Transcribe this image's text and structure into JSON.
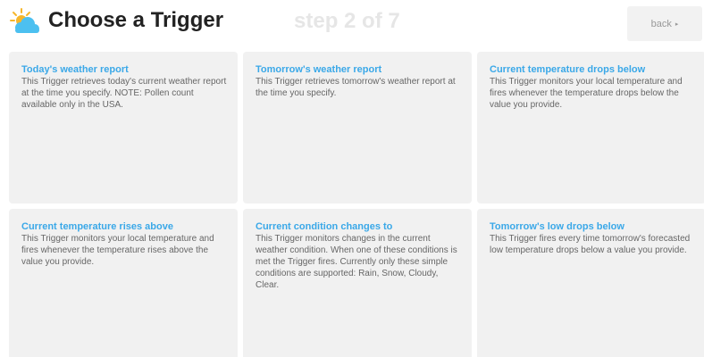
{
  "header": {
    "title": "Choose a Trigger",
    "step": "step 2 of 7",
    "back_label": "back",
    "back_caret": "▸",
    "logo_icon": "sun-cloud-icon"
  },
  "colors": {
    "title": "#222222",
    "step": "#e6e6e6",
    "card_background": "#f1f1f1",
    "card_title": "#3aa8e8",
    "card_text": "#666666",
    "logo_cloud": "#4cc0f0",
    "logo_sun": "#f6b62b"
  },
  "triggers": [
    {
      "title": "Today's weather report",
      "description": "This Trigger retrieves today's current weather report at the time you specify. NOTE: Pollen count available only in the USA."
    },
    {
      "title": "Tomorrow's weather report",
      "description": "This Trigger retrieves tomorrow's weather report at the time you specify."
    },
    {
      "title": "Current temperature drops below",
      "description": "This Trigger monitors your local temperature and fires whenever the temperature drops below the value you provide."
    },
    {
      "title": "Current temperature rises above",
      "description": "This Trigger monitors your local temperature and fires whenever the temperature rises above the value you provide."
    },
    {
      "title": "Current condition changes to",
      "description": "This Trigger monitors changes in the current weather condition. When one of these conditions is met the Trigger fires. Currently only these simple conditions are supported: Rain, Snow, Cloudy, Clear."
    },
    {
      "title": "Tomorrow's low drops below",
      "description": "This Trigger fires every time tomorrow's forecasted low temperature drops below a value you provide."
    }
  ]
}
